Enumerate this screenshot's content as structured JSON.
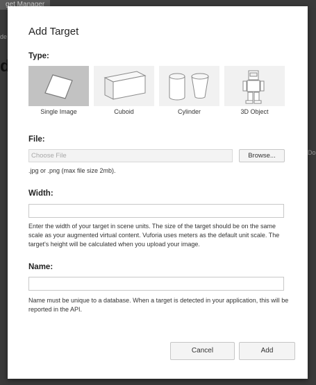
{
  "background": {
    "tab_label": "get Manager",
    "fragment_left": "de",
    "big_letter": "d",
    "fragment_right": "Do"
  },
  "modal": {
    "title": "Add Target",
    "type_label": "Type:",
    "types": [
      {
        "name": "Single Image",
        "icon": "single-image-icon",
        "selected": true
      },
      {
        "name": "Cuboid",
        "icon": "cuboid-icon",
        "selected": false
      },
      {
        "name": "Cylinder",
        "icon": "cylinder-icon",
        "selected": false
      },
      {
        "name": "3D Object",
        "icon": "3d-object-icon",
        "selected": false
      }
    ],
    "file": {
      "label": "File:",
      "placeholder": "Choose File",
      "browse_label": "Browse...",
      "hint": ".jpg or .png (max file size 2mb)."
    },
    "width": {
      "label": "Width:",
      "value": "",
      "hint": "Enter the width of your target in scene units. The size of the target should be on the same scale as your augmented virtual content. Vuforia uses meters as the default unit scale. The target's height will be calculated when you upload your image."
    },
    "name": {
      "label": "Name:",
      "value": "",
      "hint": "Name must be unique to a database. When a target is detected in your application, this will be reported in the API."
    },
    "cancel_label": "Cancel",
    "add_label": "Add"
  },
  "colors": {
    "selected_tile": "#c2c2c2",
    "tile": "#f1f1f1",
    "overlay": "#2a2a2a"
  }
}
